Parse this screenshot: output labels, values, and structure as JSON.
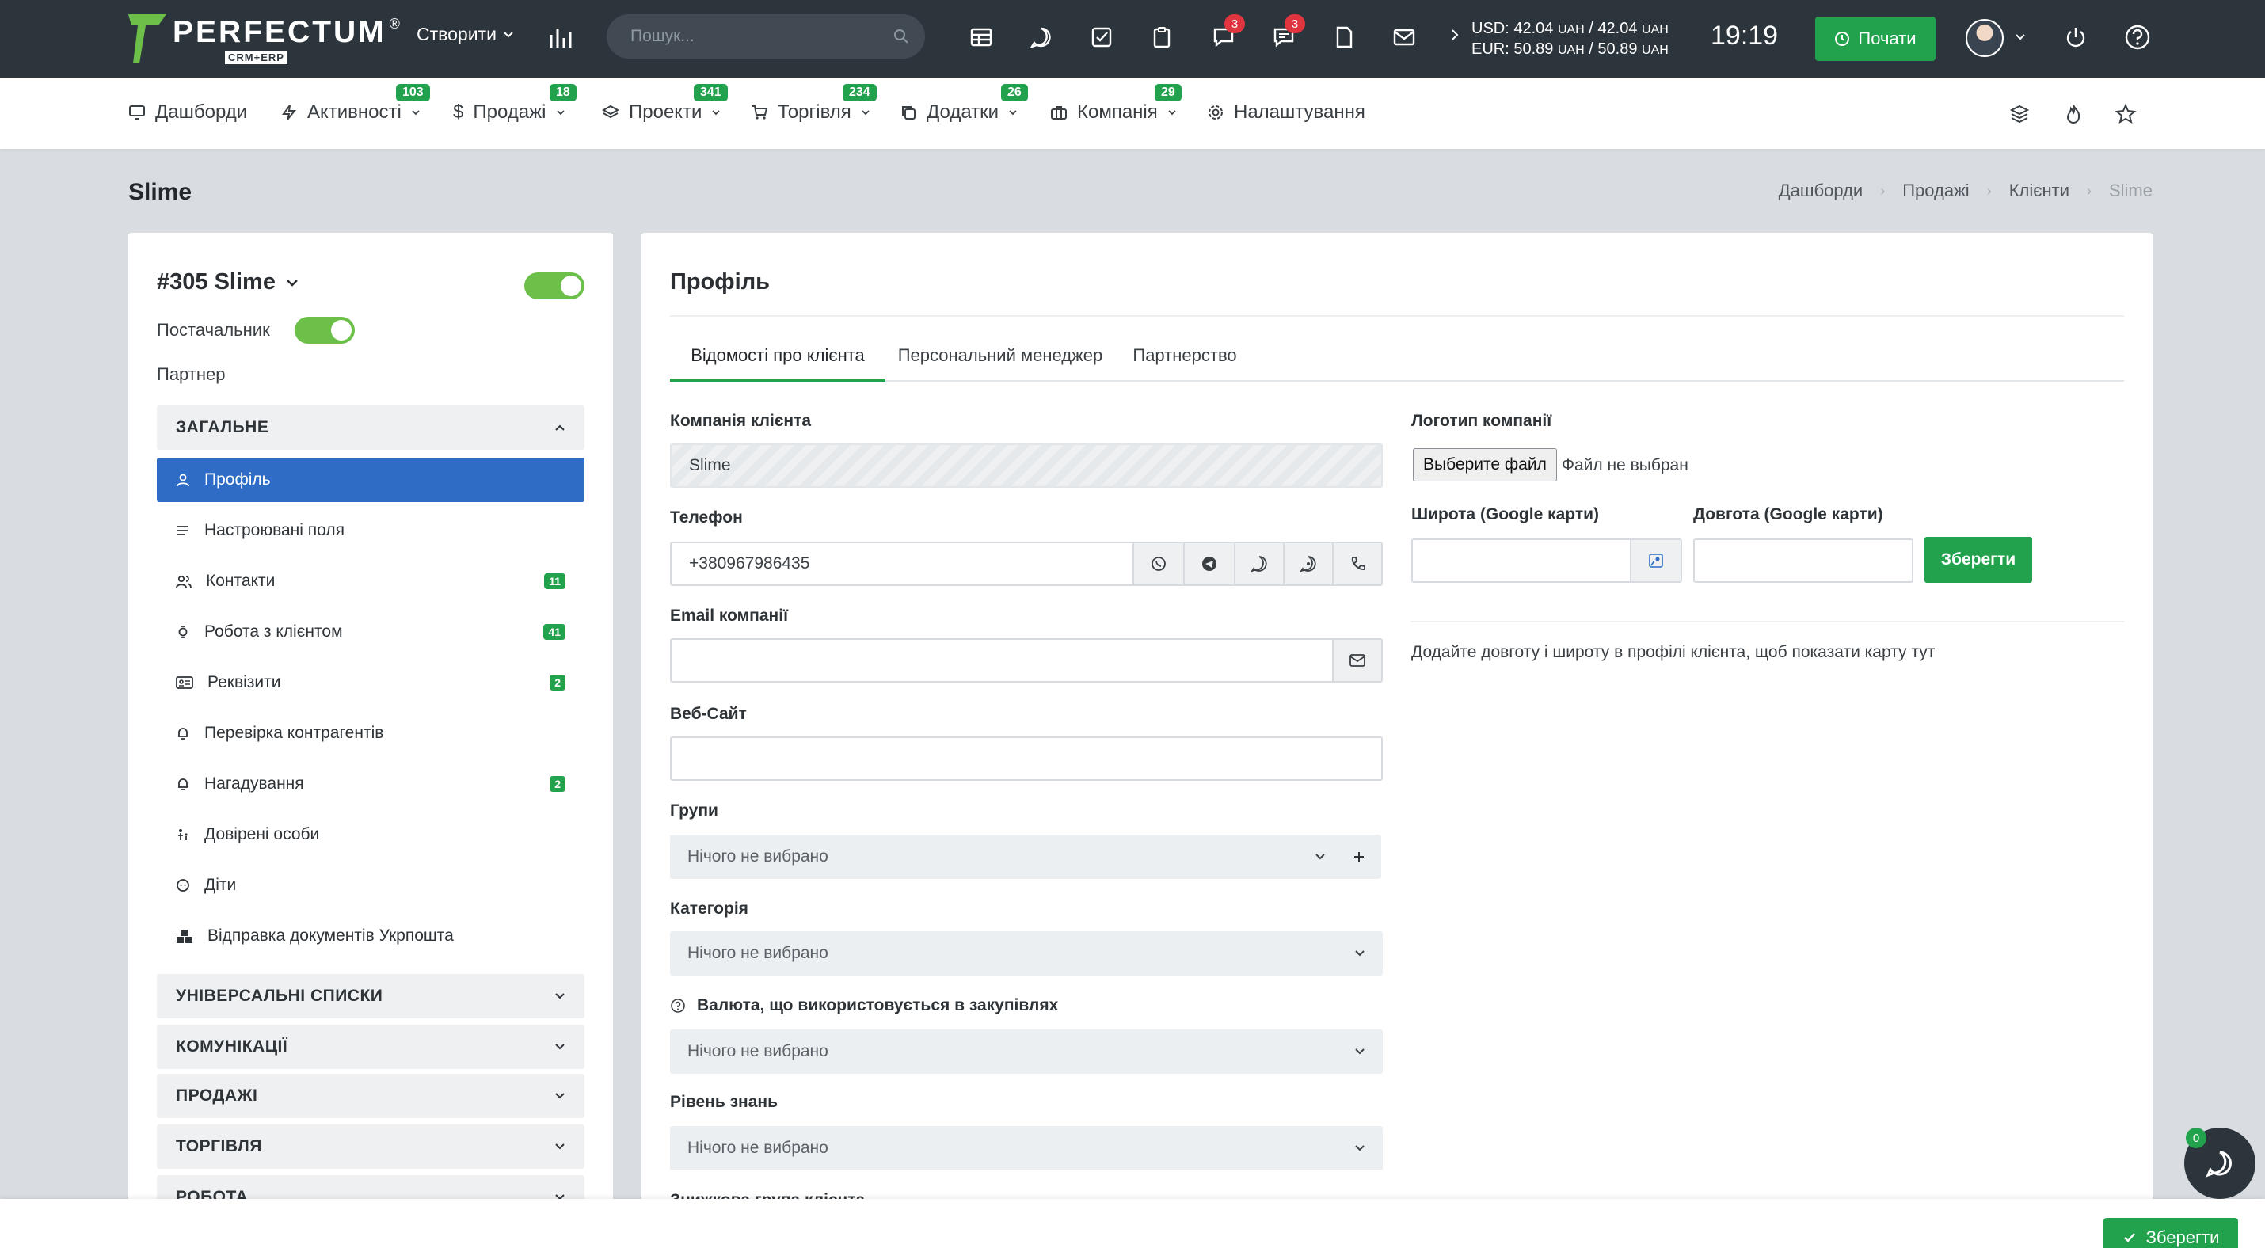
{
  "header": {
    "brand": "PERFECTUM",
    "brand_mark": "®",
    "brand_sub": "CRM+ERP",
    "create_label": "Створити",
    "search_placeholder": "Пошук...",
    "notif_badge_1": "3",
    "notif_badge_2": "3",
    "usd_rate": "USD: 42.04",
    "usd_unit": "UAH",
    "usd_rate_2": "42.04",
    "eur_rate": "EUR: 50.89",
    "eur_unit": "UAH",
    "eur_rate_2": "50.89",
    "clock": "19:19",
    "start_label": "Почати"
  },
  "nav": {
    "items": [
      {
        "label": "Дашборди",
        "badge": ""
      },
      {
        "label": "Активності",
        "badge": "103"
      },
      {
        "label": "Продажі",
        "badge": "18"
      },
      {
        "label": "Проекти",
        "badge": "341"
      },
      {
        "label": "Торгівля",
        "badge": "234"
      },
      {
        "label": "Додатки",
        "badge": "26"
      },
      {
        "label": "Компанія",
        "badge": "29"
      },
      {
        "label": "Налаштування",
        "badge": ""
      }
    ]
  },
  "page": {
    "title": "Slime",
    "breadcrumb": [
      "Дашборди",
      "Продажі",
      "Клієнти",
      "Slime"
    ]
  },
  "sidebar": {
    "client_title": "#305 Slime",
    "supplier_label": "Постачальник",
    "partner_label": "Партнер",
    "general_section": "ЗАГАЛЬНЕ",
    "items": [
      {
        "label": "Профіль",
        "count": ""
      },
      {
        "label": "Настроювані поля",
        "count": ""
      },
      {
        "label": "Контакти",
        "count": "11"
      },
      {
        "label": "Робота з клієнтом",
        "count": "41"
      },
      {
        "label": "Реквізити",
        "count": "2"
      },
      {
        "label": "Перевірка контрагентів",
        "count": ""
      },
      {
        "label": "Нагадування",
        "count": "2"
      },
      {
        "label": "Довірені особи",
        "count": ""
      },
      {
        "label": "Діти",
        "count": ""
      },
      {
        "label": "Відправка документів Укрпошта",
        "count": ""
      }
    ],
    "sections": [
      "УНІВЕРСАЛЬНІ СПИСКИ",
      "КОМУНІКАЦІЇ",
      "ПРОДАЖІ",
      "ТОРГІВЛЯ",
      "РОБОТА"
    ]
  },
  "profile": {
    "title": "Профіль",
    "tabs": [
      "Відомості про клієнта",
      "Персональний менеджер",
      "Партнерство"
    ],
    "company_label": "Компанія клієнта",
    "company_value": "Slime",
    "phone_label": "Телефон",
    "phone_value": "+380967986435",
    "email_label": "Email компанії",
    "email_value": "",
    "website_label": "Веб-Сайт",
    "website_value": "",
    "groups_label": "Групи",
    "groups_value": "Нічого не вибрано",
    "category_label": "Категорія",
    "category_value": "Нічого не вибрано",
    "currency_label": "Валюта, що використовується в закупівлях",
    "currency_value": "Нічого не вибрано",
    "knowledge_label": "Рівень знань",
    "knowledge_value": "Нічого не вибрано",
    "discount_label": "Знижкова група клієнта",
    "logo_label": "Логотип компанії",
    "file_button": "Выберите файл",
    "file_status": "Файл не выбран",
    "lat_label": "Широта (Google карти)",
    "lng_label": "Довгота (Google карти)",
    "save_label": "Зберегти",
    "map_note": "Додайте довготу і широту в профілі клієнта, щоб показати карту тут"
  },
  "footer": {
    "save_label": "Зберегти",
    "chat_badge": "0"
  },
  "colors": {
    "topbar": "#2c343c",
    "accent_green": "#23a24d",
    "active_blue": "#2f6cc5",
    "badge_red": "#e0343f"
  }
}
